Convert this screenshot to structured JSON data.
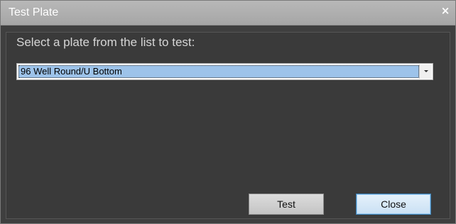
{
  "window": {
    "title": "Test Plate",
    "close_glyph": "×"
  },
  "main": {
    "prompt": "Select a plate from the list to test:",
    "plate_select": {
      "selected_value": "96 Well Round/U Bottom"
    }
  },
  "buttons": {
    "test_label": "Test",
    "close_label": "Close"
  },
  "icons": {
    "window_close": "close-icon",
    "dropdown": "chevron-down-icon"
  },
  "colors": {
    "titlebar": "#aeaeae",
    "dialog_background": "#3f3f3f",
    "selection_highlight": "#9dc3ea",
    "default_button_border": "#3c7fb1"
  }
}
